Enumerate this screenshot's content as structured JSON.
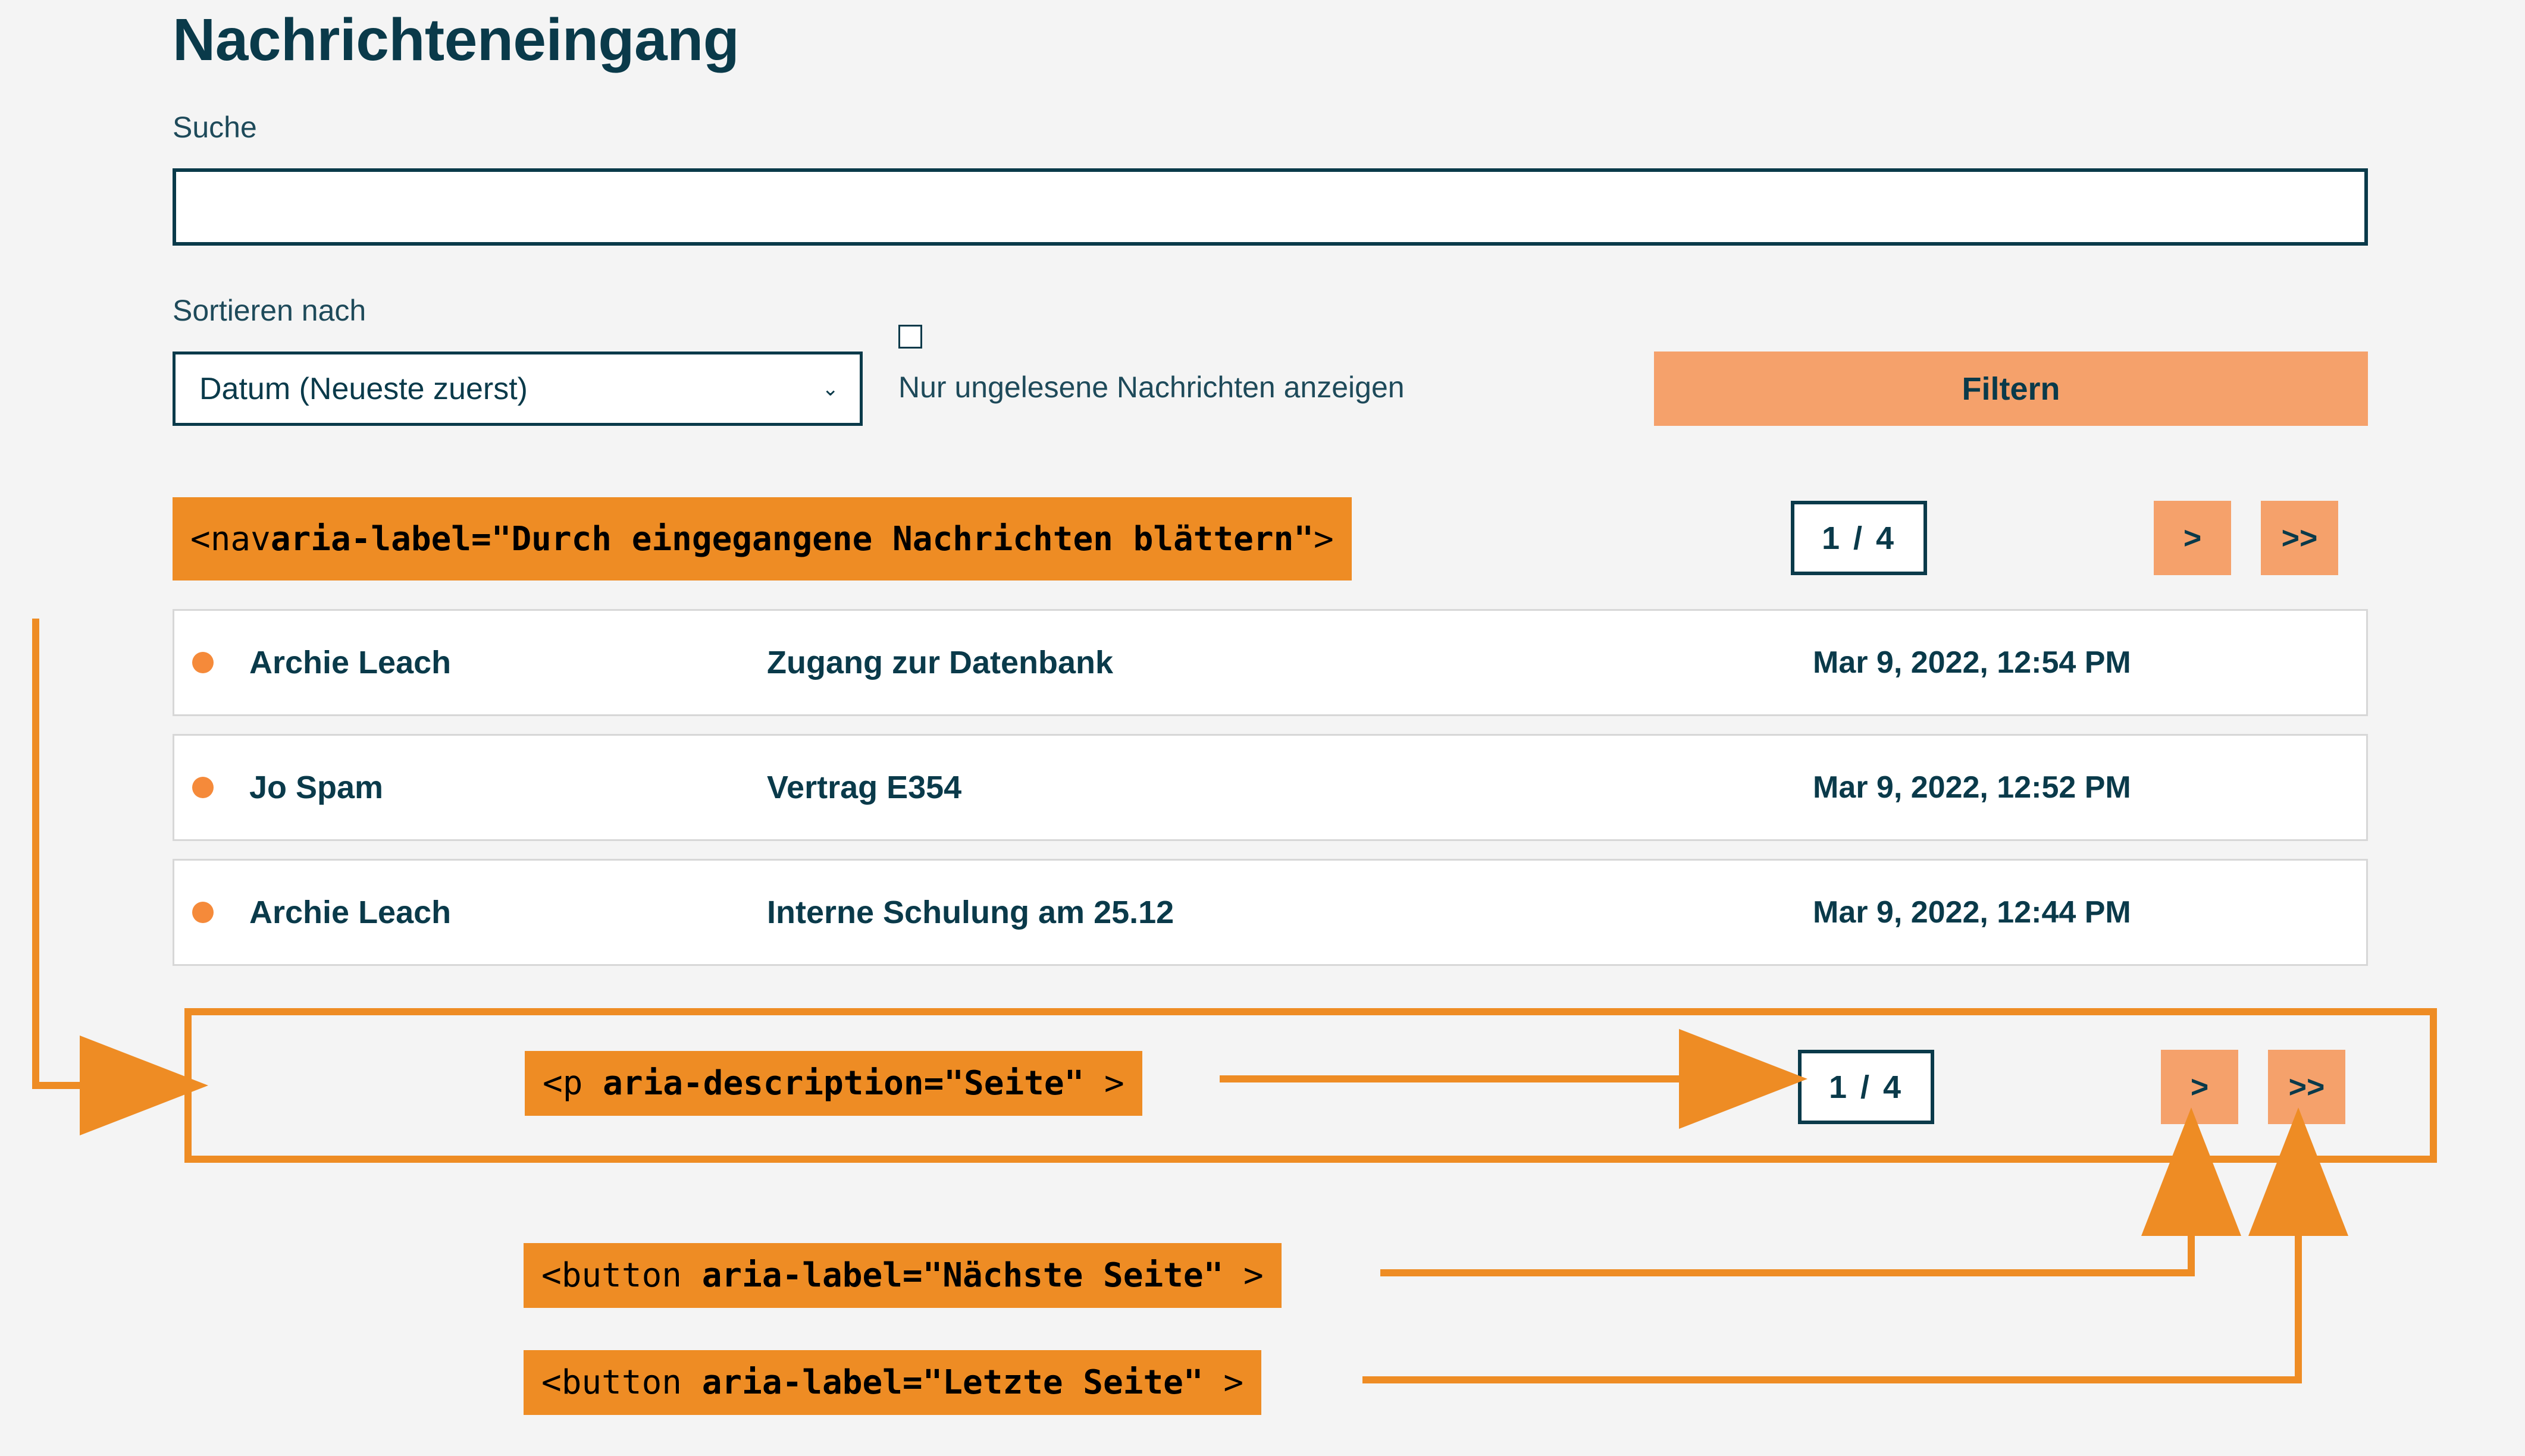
{
  "page": {
    "title": "Nachrichteneingang",
    "search_label": "Suche",
    "search_value": ""
  },
  "filters": {
    "sort_label": "Sortieren nach",
    "sort_value": "Datum (Neueste zuerst)",
    "unread_label": "Nur ungelesene Nachrichten anzeigen",
    "filter_button": "Filtern"
  },
  "pagination": {
    "indicator": "1 / 4",
    "next_glyph": ">",
    "last_glyph": ">>"
  },
  "messages": [
    {
      "sender": "Archie Leach",
      "subject": "Zugang zur Datenbank",
      "date": "Mar 9, 2022, 12:54 PM"
    },
    {
      "sender": "Jo Spam",
      "subject": "Vertrag E354",
      "date": "Mar 9, 2022, 12:52 PM"
    },
    {
      "sender": "Archie Leach",
      "subject": "Interne Schulung am 25.12",
      "date": "Mar 9, 2022, 12:44 PM"
    }
  ],
  "annotations": {
    "nav_prefix": "<nav ",
    "nav_attr": "aria-label=\"Durch eingegangene Nachrichten blättern\"",
    "nav_suffix": ">",
    "p_prefix": "<p ",
    "p_attr": "aria-description=\"Seite\"",
    "p_suffix": ">",
    "btn_next_prefix": "<button ",
    "btn_next_attr": "aria-label=\"Nächste Seite\"",
    "btn_next_suffix": ">",
    "btn_last_prefix": "<button ",
    "btn_last_attr": "aria-label=\"Letzte Seite\"",
    "btn_last_suffix": ">"
  }
}
